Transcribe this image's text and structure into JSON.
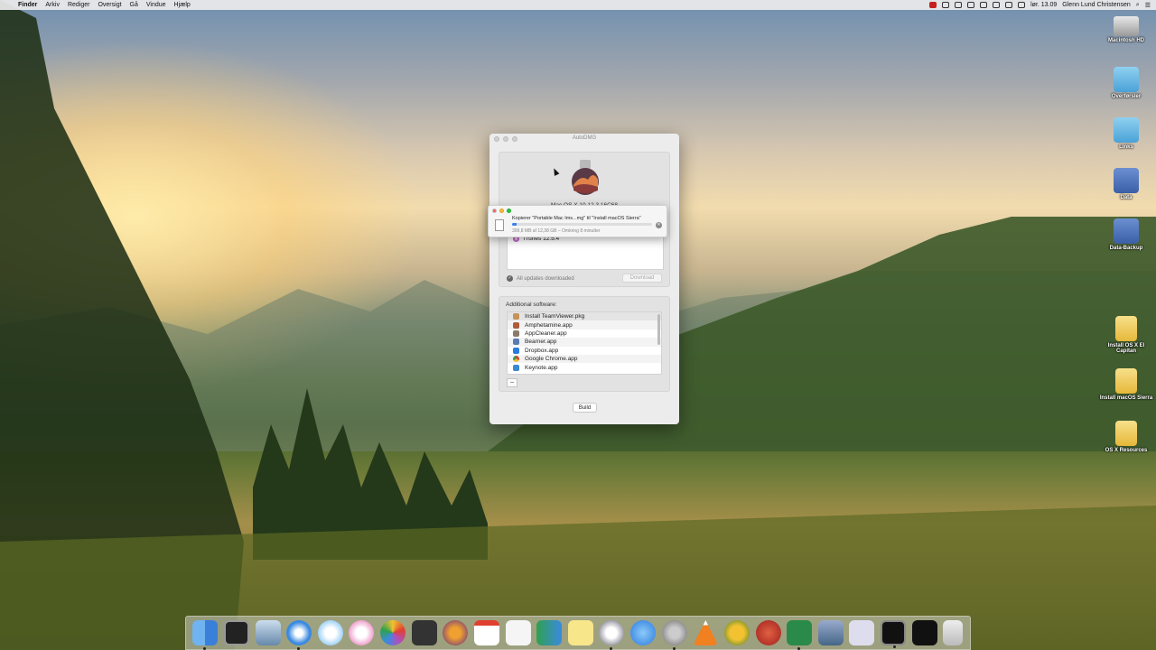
{
  "menubar": {
    "apple": "",
    "items": [
      "Finder",
      "Arkiv",
      "Rediger",
      "Oversigt",
      "Gå",
      "Vindue",
      "Hjælp"
    ],
    "clock": "lør. 13.09",
    "user": "Glenn Lund Christensen"
  },
  "desktop_icons": [
    {
      "label": "Macintosh HD",
      "icon": "hard-drive-icon"
    },
    {
      "label": "Overførsler",
      "icon": "downloads-folder-icon"
    },
    {
      "label": "Links",
      "icon": "links-folder-icon"
    },
    {
      "label": "Data",
      "icon": "network-server-icon"
    },
    {
      "label": "Data-Backup",
      "icon": "network-server-icon"
    },
    {
      "label": "Install OS X El Capitan",
      "icon": "disk-image-icon"
    },
    {
      "label": "Install macOS Sierra",
      "icon": "disk-image-icon"
    },
    {
      "label": "OS X Resources",
      "icon": "disk-image-icon"
    }
  ],
  "window": {
    "title": "AutoDMG",
    "installer_label": "Mac OS X 10.12.3 16C68",
    "updates": [
      {
        "name": "iTunes 12.5.4"
      }
    ],
    "updates_status": "All updates downloaded",
    "download_label": "Download",
    "additional_title": "Additional software:",
    "software": [
      "Install TeamViewer.pkg",
      "Amphetamine.app",
      "AppCleaner.app",
      "Bearner.app",
      "Dropbox.app",
      "Google Chrome.app",
      "Keynote.app"
    ],
    "minus_label": "−",
    "build_label": "Build"
  },
  "copy_panel": {
    "title": "Kopierer \"Portable Mac Ims...mg\" til \"Install macOS Sierra\"",
    "status": "399,8 MB af 12,38 GB – Omkring 8 minutter",
    "progress": 0.03
  },
  "dock": [
    "finder-icon",
    "activity-monitor-icon",
    "preview-icon",
    "safari-icon",
    "messages-icon",
    "itunes-icon",
    "photos-icon",
    "cube-app-icon",
    "firefox-icon",
    "calendar-icon",
    "textedit-icon",
    "numbers-icon",
    "notes-icon",
    "disk-utility-icon",
    "app-store-icon",
    "system-preferences-icon",
    "vlc-icon",
    "pineapple-app-icon",
    "tomato-app-icon",
    "coda-icon",
    "xcode-docs-icon",
    "installer-icon",
    "terminal-icon",
    "console-icon",
    "trash-icon"
  ],
  "colors": {
    "accent": "#3b82f0",
    "close": "#fc5f57",
    "minimize": "#fdbc2e",
    "zoom": "#28c840"
  }
}
